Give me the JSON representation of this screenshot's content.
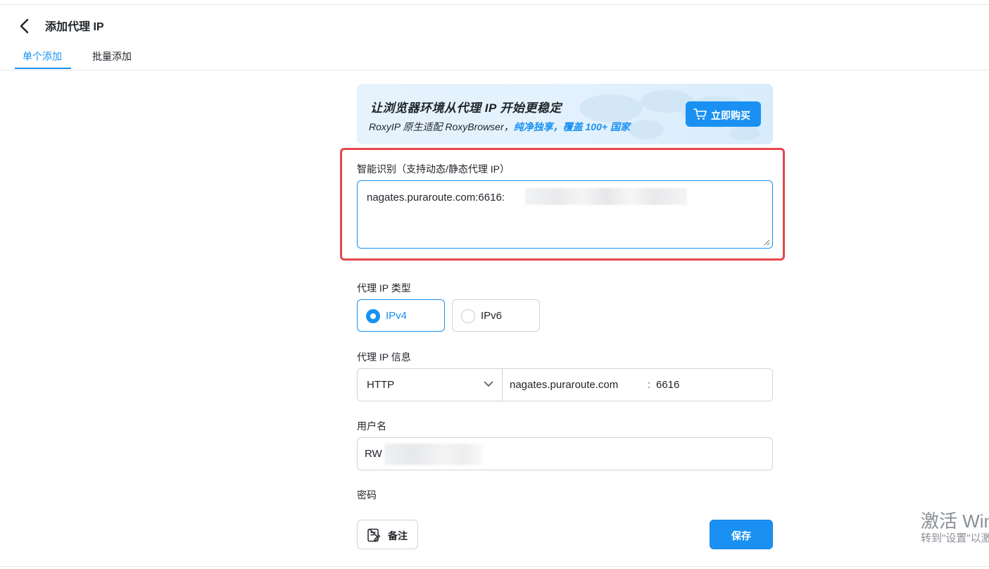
{
  "header": {
    "title": "添加代理 IP"
  },
  "tabs": [
    {
      "label": "单个添加",
      "active": true
    },
    {
      "label": "批量添加",
      "active": false
    }
  ],
  "banner": {
    "title": "让浏览器环境从代理 IP 开始更稳定",
    "subtitle_prefix": "RoxyIP 原生适配 RoxyBrowser，",
    "subtitle_highlight": "纯净独享，覆盖 100+ 国家",
    "buy_label": "立即购买",
    "buy_icon": "cart-icon"
  },
  "smart_detect": {
    "label": "智能识别（支持动态/静态代理 IP）",
    "value": "nagates.puraroute.com:6616:"
  },
  "proxy_type": {
    "label": "代理 IP 类型",
    "options": [
      {
        "label": "IPv4",
        "selected": true
      },
      {
        "label": "IPv6",
        "selected": false
      }
    ]
  },
  "proxy_info": {
    "label": "代理 IP 信息",
    "protocol": "HTTP",
    "host": "nagates.puraroute.com",
    "separator": ":",
    "port": "6616"
  },
  "username": {
    "label": "用户名",
    "value": "RW"
  },
  "password": {
    "label": "密码"
  },
  "footer": {
    "note_label": "备注",
    "save_label": "保存"
  },
  "watermark": {
    "line1": "激活 Windows",
    "line2": "转到\"设置\"以激活 Windows。"
  },
  "colors": {
    "accent": "#1a91f2",
    "highlight_border": "#e5484d"
  }
}
